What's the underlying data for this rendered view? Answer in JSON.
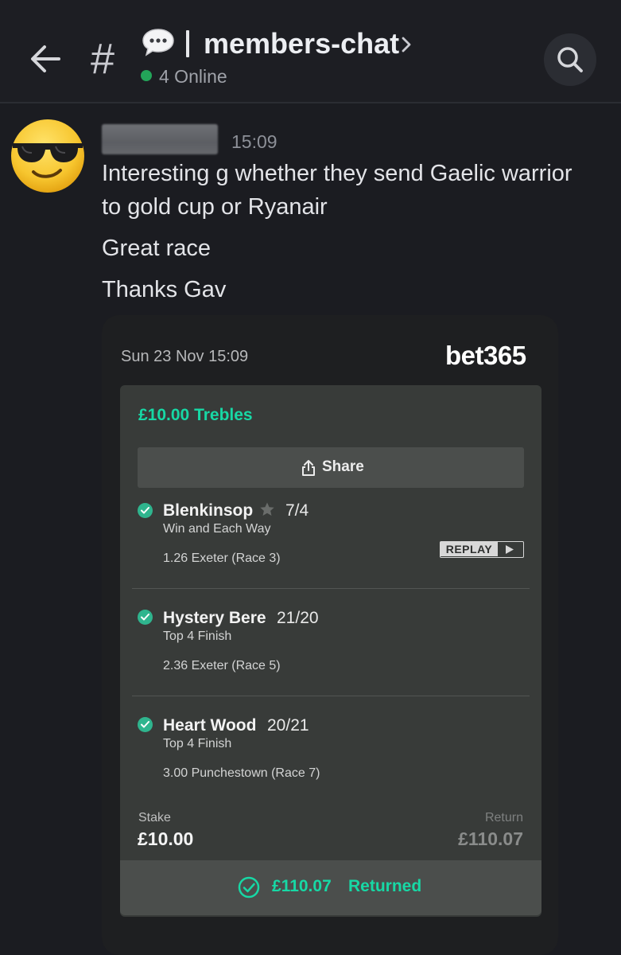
{
  "header": {
    "channel_name": "members-chat",
    "online_text": "4 Online",
    "channel_emoji": "speech-bubble"
  },
  "message": {
    "timestamp": "15:09",
    "lines": [
      "Interesting g whether they send Gaelic warrior",
      "to gold cup or Ryanair",
      "Great race",
      "Thanks Gav"
    ]
  },
  "betslip": {
    "date": "Sun 23 Nov 15:09",
    "brand": "bet365",
    "title": "£10.00 Trebles",
    "share_label": "Share",
    "replay_label": "REPLAY",
    "selections": [
      {
        "name": "Blenkinsop",
        "odds": "7/4",
        "market": "Win and Each Way",
        "race": "1.26 Exeter (Race 3)"
      },
      {
        "name": "Hystery Bere",
        "odds": "21/20",
        "market": "Top 4 Finish",
        "race": "2.36 Exeter (Race 5)"
      },
      {
        "name": "Heart Wood",
        "odds": "20/21",
        "market": "Top 4 Finish",
        "race": "3.00 Punchestown (Race 7)"
      }
    ],
    "stake_label": "Stake",
    "stake_value": "£10.00",
    "return_label": "Return",
    "return_value": "£110.07",
    "returned_amount": "£110.07",
    "returned_label": "Returned"
  },
  "colors": {
    "accent_green": "#17d8a5",
    "online_green": "#23a559",
    "background": "#1b1c21"
  }
}
